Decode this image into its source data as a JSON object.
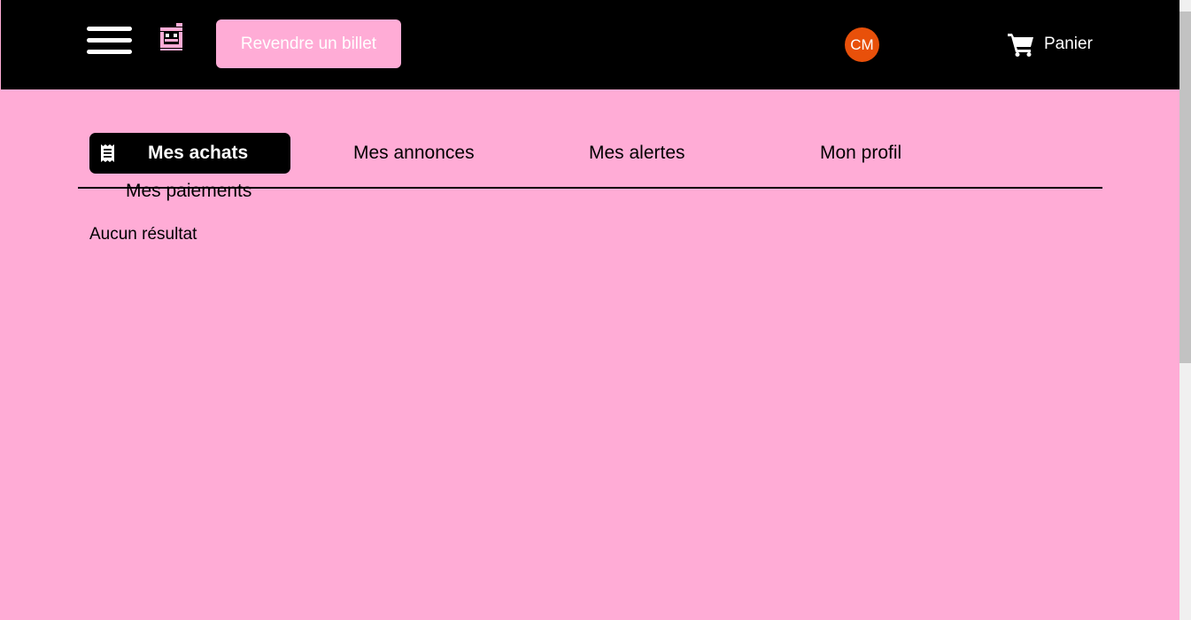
{
  "header": {
    "resell_button": "Revendre un billet",
    "avatar_initials": "CM",
    "cart_label": "Panier",
    "icons": {
      "menu": "hamburger-menu-icon",
      "logo": "pixel-logo-icon",
      "cart": "shopping-cart-icon"
    }
  },
  "tabs": {
    "active": {
      "label": "Mes achats",
      "icon": "receipt-icon"
    },
    "items": [
      {
        "label": "Mes annonces"
      },
      {
        "label": "Mes alertes"
      },
      {
        "label": "Mon profil"
      },
      {
        "label": "Mes paiements"
      }
    ]
  },
  "main": {
    "empty_message": "Aucun résultat"
  },
  "colors": {
    "background": "#ffacd6",
    "header": "#000000",
    "accent_button": "#ffacd6",
    "avatar": "#e8500a",
    "text": "#000000"
  }
}
